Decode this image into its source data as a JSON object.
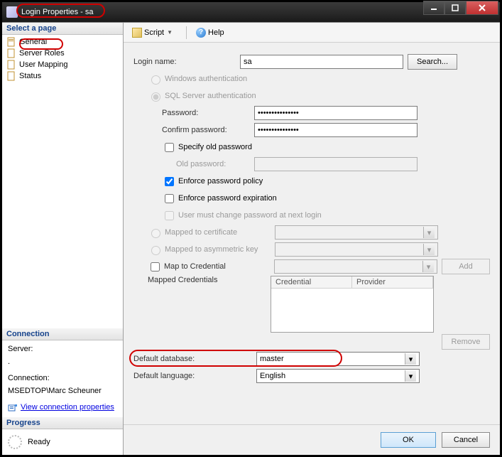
{
  "window": {
    "title": "Login Properties - sa"
  },
  "annotations": {
    "title_highlighted": true,
    "general_highlighted": true,
    "default_db_highlighted": true
  },
  "sidebar": {
    "select_page_label": "Select a page",
    "pages": [
      {
        "label": "General"
      },
      {
        "label": "Server Roles"
      },
      {
        "label": "User Mapping"
      },
      {
        "label": "Status"
      }
    ],
    "connection_label": "Connection",
    "server_label": "Server:",
    "server_value": ".",
    "connection_field_label": "Connection:",
    "connection_value": "MSEDTOP\\Marc Scheuner",
    "view_conn_props": "View connection properties",
    "progress_label": "Progress",
    "progress_status": "Ready"
  },
  "toolbar": {
    "script": "Script",
    "help": "Help"
  },
  "form": {
    "login_name_label": "Login name:",
    "login_name_value": "sa",
    "search_btn": "Search...",
    "auth_windows": "Windows authentication",
    "auth_sql": "SQL Server authentication",
    "auth_mode": "sql",
    "password_label": "Password:",
    "password_value": "•••••••••••••••",
    "confirm_label": "Confirm password:",
    "confirm_value": "•••••••••••••••",
    "specify_old": "Specify old password",
    "specify_old_checked": false,
    "old_password_label": "Old password:",
    "enforce_policy": "Enforce password policy",
    "enforce_policy_checked": true,
    "enforce_expiration": "Enforce password expiration",
    "enforce_expiration_checked": false,
    "must_change": "User must change password at next login",
    "mapped_cert": "Mapped to certificate",
    "mapped_asym": "Mapped to asymmetric key",
    "map_cred": "Map to Credential",
    "map_cred_checked": false,
    "add_btn": "Add",
    "mapped_creds_label": "Mapped Credentials",
    "cred_col_credential": "Credential",
    "cred_col_provider": "Provider",
    "remove_btn": "Remove",
    "default_db_label": "Default database:",
    "default_db_value": "master",
    "default_lang_label": "Default language:",
    "default_lang_value": "English"
  },
  "footer": {
    "ok": "OK",
    "cancel": "Cancel"
  }
}
